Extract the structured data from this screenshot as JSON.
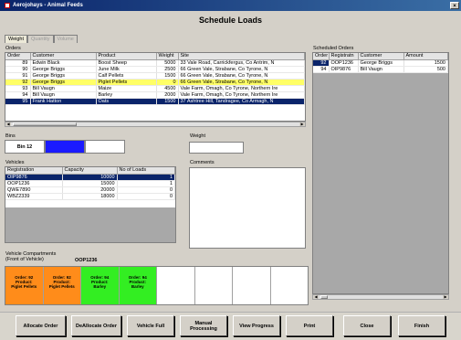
{
  "window": {
    "title": "Aerojohays - Animal Feeds",
    "close_label": "×"
  },
  "page_title": "Schedule Loads",
  "tabs": [
    "Weight",
    "Quantity",
    "Volume"
  ],
  "orders": {
    "label": "Orders",
    "columns": [
      "Order",
      "Customer",
      "Product",
      "Weight",
      "Site"
    ],
    "rows": [
      {
        "order": "89",
        "customer": "Edwin Black",
        "product": "Boost Sheep",
        "weight": "5000",
        "site": "33 Vale Road, Carrickfergus, Co Antrim, N"
      },
      {
        "order": "90",
        "customer": "George Briggs",
        "product": "June Milk",
        "weight": "2500",
        "site": "66 Green Vale, Strabane, Co Tyrone, N"
      },
      {
        "order": "91",
        "customer": "George Briggs",
        "product": "Calf Pellets",
        "weight": "1500",
        "site": "66 Green Vale, Strabane, Co Tyrone, N"
      },
      {
        "order": "92",
        "customer": "George Briggs",
        "product": "Piglet Pellets",
        "weight": "0",
        "site": "66 Green Vale, Strabane, Co Tyrone, N"
      },
      {
        "order": "93",
        "customer": "Bill Vaugn",
        "product": "Maize",
        "weight": "4500",
        "site": "Vale Farm, Omagh, Co Tyrone, Northern Ire"
      },
      {
        "order": "94",
        "customer": "Bill Vaugn",
        "product": "Barley",
        "weight": "2000",
        "site": "Vale Farm, Omagh, Co Tyrone, Northern Ire"
      },
      {
        "order": "95",
        "customer": "Frank Hatton",
        "product": "Oats",
        "weight": "1500",
        "site": "37 Ashtree Hill, Tandragee, Co Armagh, N"
      }
    ]
  },
  "bins": {
    "label": "Bins",
    "items": [
      "Bin 12",
      "",
      ""
    ]
  },
  "weight_label": "Weight",
  "weight_value": "",
  "vehicles": {
    "label": "Vehicles",
    "columns": [
      "Registration",
      "Capacity",
      "No of Loads"
    ],
    "rows": [
      {
        "reg": "OIP9876",
        "capacity": "10000",
        "loads": "1"
      },
      {
        "reg": "OOP1236",
        "capacity": "15000",
        "loads": "1"
      },
      {
        "reg": "QWE7890",
        "capacity": "20000",
        "loads": "0"
      },
      {
        "reg": "WBZ2339",
        "capacity": "18000",
        "loads": "0"
      }
    ]
  },
  "comments": {
    "label": "Comments",
    "value": ""
  },
  "compartments": {
    "label_line1": "Vehicle Compartments",
    "label_line2": "(Front of Vehicle)",
    "vehicle": "OOP1236",
    "items": [
      {
        "order": "Order: 92",
        "product": "Product:",
        "name": "Piglet Pellets",
        "color": "#ff8c1a"
      },
      {
        "order": "Order: 92",
        "product": "Product:",
        "name": "Piglet Pellets",
        "color": "#ff8c1a"
      },
      {
        "order": "Order: 94",
        "product": "Product:",
        "name": "Barley",
        "color": "#33ee22"
      },
      {
        "order": "Order: 94",
        "product": "Product:",
        "name": "Barley",
        "color": "#33ee22"
      }
    ]
  },
  "scheduled": {
    "label": "Scheduled Orders",
    "columns": [
      "Order",
      "Registratn",
      "Customer",
      "Amount"
    ],
    "rows": [
      {
        "order": "92",
        "reg": "OOP1236",
        "customer": "George Briggs",
        "amount": "1500"
      },
      {
        "order": "94",
        "reg": "OIP9876",
        "customer": "Bill Vaugn",
        "amount": "500"
      }
    ]
  },
  "buttons": {
    "allocate": "Allocate Order",
    "deallocate": "DeAllocate Order",
    "vehicle_full": "Vehicle Full",
    "manual": "Manual Processing",
    "view_progress": "View Progress",
    "print": "Print",
    "close": "Close",
    "finish": "Finish"
  }
}
